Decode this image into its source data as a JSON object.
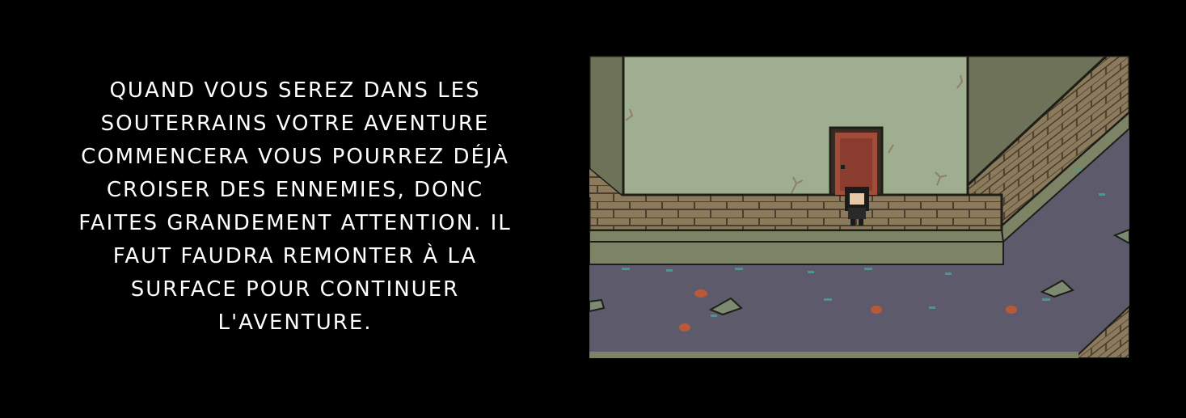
{
  "description": {
    "lines": [
      "QUAND VOUS SEREZ DANS LES",
      "SOUTERRAINS VOTRE AVENTURE",
      "COMMENCERA VOUS POURREZ DÉJÀ",
      "CROISER DES ENNEMIES, DONC",
      "FAITES GRANDEMENT ATTENTION. IL",
      "FAUT FAUDRA REMONTER À LA",
      "SURFACE POUR CONTINUER",
      "L'AVENTURE."
    ]
  },
  "colors": {
    "background": "#000000",
    "text": "#ffffff",
    "wall": "#9fad90",
    "brick": "#8c7a5c",
    "sewer_water": "#5d5a6b",
    "door": "#a24c3a"
  }
}
